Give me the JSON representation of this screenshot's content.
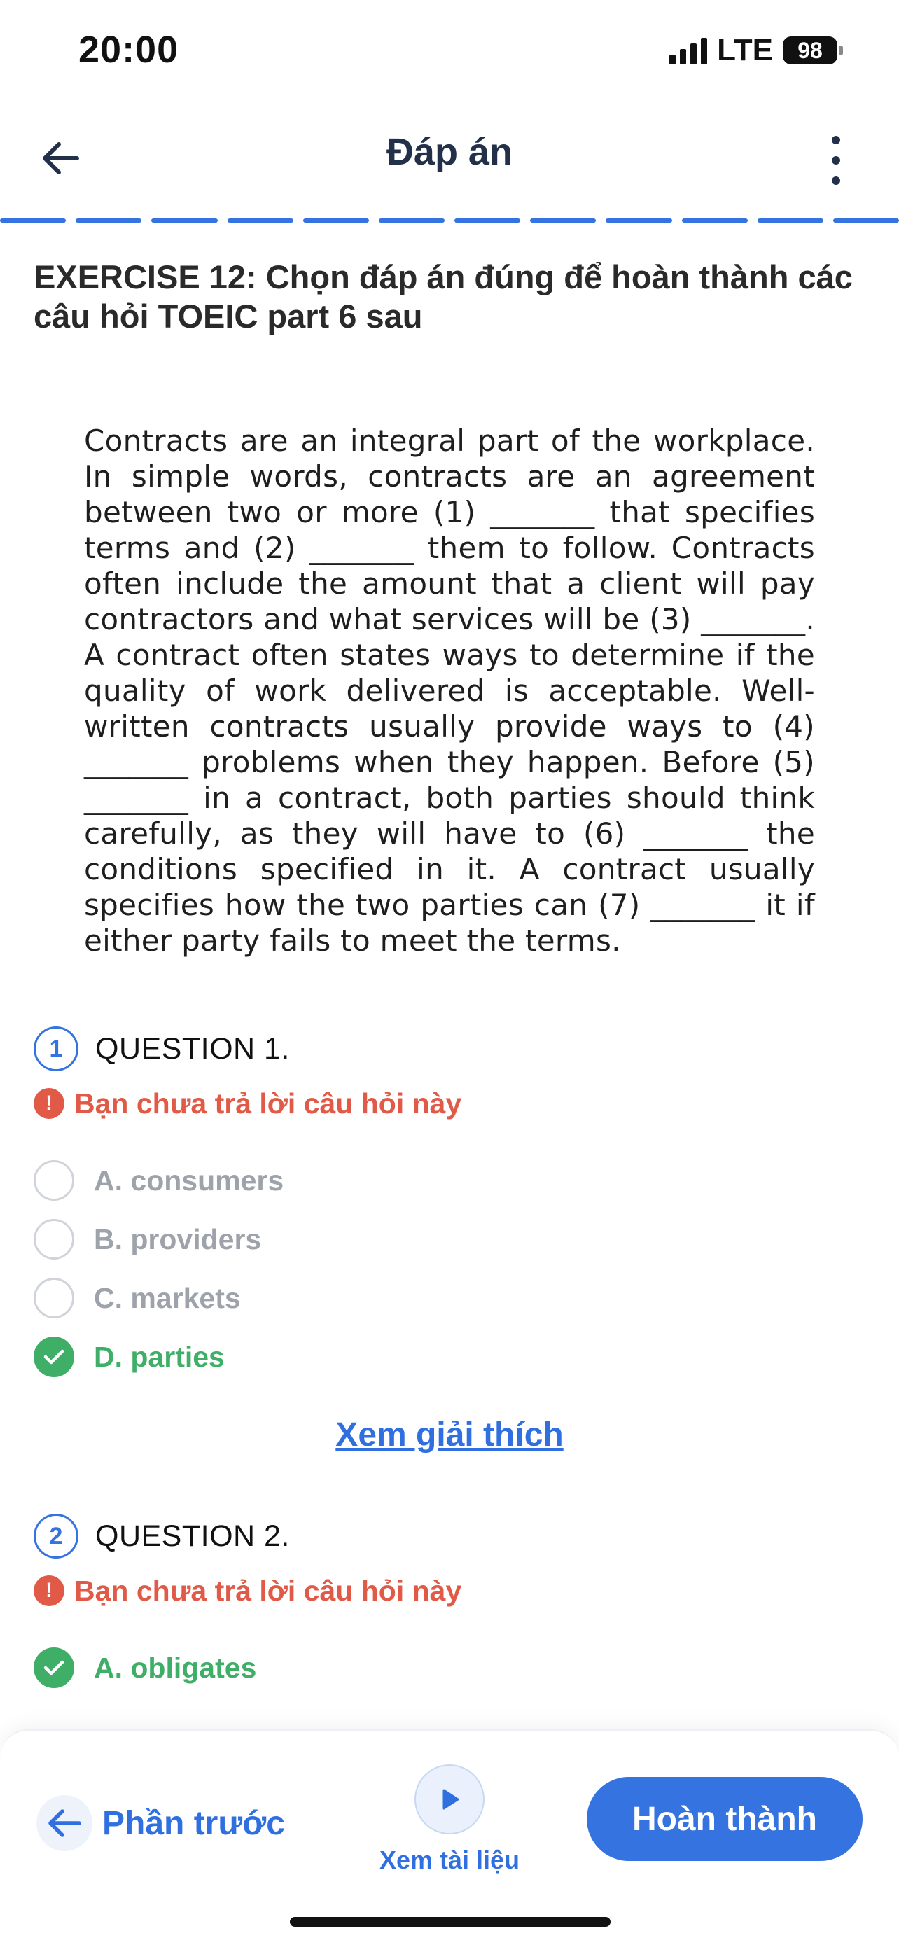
{
  "status_bar": {
    "time": "20:00",
    "network": "LTE",
    "battery": "98"
  },
  "header": {
    "title": "Đáp án",
    "back_icon": "arrow-left-icon",
    "more_icon": "more-vertical-icon"
  },
  "progress": {
    "segments": 12,
    "color": "#3574e0"
  },
  "exercise": {
    "title": "EXERCISE 12: Chọn đáp án đúng để hoàn thành các câu hỏi TOEIC part 6 sau",
    "passage": "Contracts are an integral part of the workplace. In simple words, contracts are an agreement between two or more (1) _______ that specifies terms and (2) _______ them to follow. Contracts often include the amount that a client will pay contractors and what services will be (3) _______. A contract often states ways to determine if the quality of work delivered is acceptable. Well-written contracts usually provide ways to (4) _______ problems when they happen. Before (5) _______ in a contract, both parties should think carefully, as they will have to (6) _______ the conditions specified in it. A contract usually specifies how the two parties can (7) _______ it if either party fails to meet the terms."
  },
  "questions": [
    {
      "number": "1",
      "label": "QUESTION 1.",
      "warning": "Bạn chưa trả lời câu hỏi này",
      "options": [
        {
          "text": "A. consumers",
          "correct": false
        },
        {
          "text": "B. providers",
          "correct": false
        },
        {
          "text": "C. markets",
          "correct": false
        },
        {
          "text": "D. parties",
          "correct": true
        }
      ]
    },
    {
      "number": "2",
      "label": "QUESTION 2.",
      "warning": "Bạn chưa trả lời câu hỏi này",
      "options": [
        {
          "text": "A. obligates",
          "correct": true
        }
      ]
    }
  ],
  "explain_link": "Xem giải thích",
  "bottom_bar": {
    "prev_label": "Phần trước",
    "doc_label": "Xem tài liệu",
    "finish_label": "Hoàn thành"
  },
  "colors": {
    "accent": "#3574e0",
    "correct": "#3fae66",
    "warning": "#e15a47",
    "unselected": "#9ea3ab"
  }
}
